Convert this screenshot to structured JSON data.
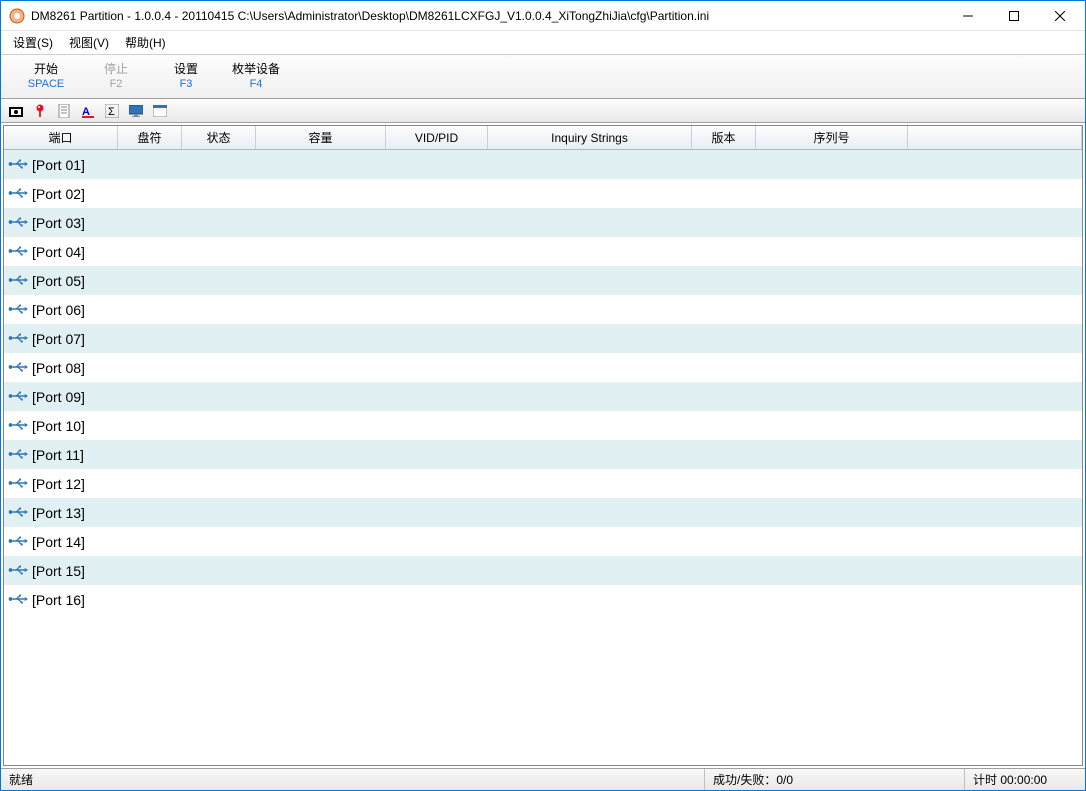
{
  "title": "DM8261 Partition - 1.0.0.4 - 20110415  C:\\Users\\Administrator\\Desktop\\DM8261LCXFGJ_V1.0.0.4_XiTongZhiJia\\cfg\\Partition.ini",
  "menu": {
    "settings": "设置(S)",
    "view": "视图(V)",
    "help": "帮助(H)"
  },
  "toolbar": {
    "start": {
      "label": "开始",
      "hotkey": "SPACE"
    },
    "stop": {
      "label": "停止",
      "hotkey": "F2"
    },
    "settings": {
      "label": "设置",
      "hotkey": "F3"
    },
    "enum": {
      "label": "枚举设备",
      "hotkey": "F4"
    }
  },
  "columns": {
    "port": "端口",
    "drive": "盘符",
    "status": "状态",
    "capacity": "容量",
    "vidpid": "VID/PID",
    "inquiry": "Inquiry Strings",
    "version": "版本",
    "serial": "序列号"
  },
  "rows": [
    {
      "port": "[Port 01]"
    },
    {
      "port": "[Port 02]"
    },
    {
      "port": "[Port 03]"
    },
    {
      "port": "[Port 04]"
    },
    {
      "port": "[Port 05]"
    },
    {
      "port": "[Port 06]"
    },
    {
      "port": "[Port 07]"
    },
    {
      "port": "[Port 08]"
    },
    {
      "port": "[Port 09]"
    },
    {
      "port": "[Port 10]"
    },
    {
      "port": "[Port 11]"
    },
    {
      "port": "[Port 12]"
    },
    {
      "port": "[Port 13]"
    },
    {
      "port": "[Port 14]"
    },
    {
      "port": "[Port 15]"
    },
    {
      "port": "[Port 16]"
    }
  ],
  "status": {
    "ready": "就绪",
    "ratio": "成功/失败：0/0",
    "timer": "计时 00:00:00"
  }
}
